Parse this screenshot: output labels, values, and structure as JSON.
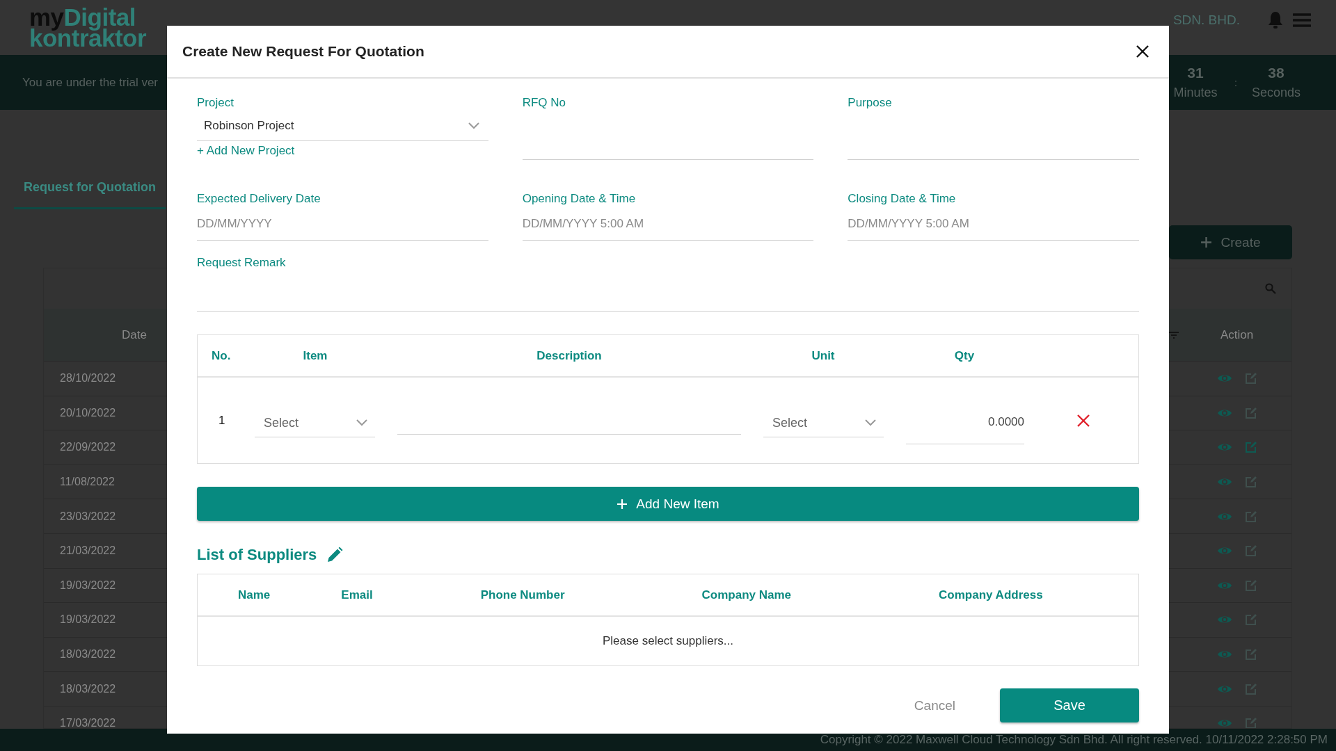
{
  "app": {
    "logo": {
      "part1": "my",
      "part2": "Digital",
      "line2": "kontraktor"
    },
    "company": "SDN. BHD.",
    "trial_banner": "You are under the trial ver",
    "countdown": [
      {
        "value": "31",
        "unit": "Minutes"
      },
      {
        "value": "38",
        "unit": "Seconds"
      }
    ],
    "countdown_separator": ":",
    "tabs": [
      {
        "label": "Request for Quotation",
        "selected": true
      }
    ],
    "create_button": "Create",
    "table": {
      "columns": [
        "Date",
        "Action"
      ],
      "rows": [
        {
          "date": "28/10/2022",
          "edit_highlighted": false
        },
        {
          "date": "20/10/2022",
          "edit_highlighted": false
        },
        {
          "date": "22/09/2022",
          "edit_highlighted": true
        },
        {
          "date": "11/08/2022",
          "edit_highlighted": false
        },
        {
          "date": "23/03/2022",
          "edit_highlighted": false
        },
        {
          "date": "21/03/2022",
          "edit_highlighted": false
        },
        {
          "date": "19/03/2022",
          "edit_highlighted": false
        },
        {
          "date": "19/03/2022",
          "edit_highlighted": false
        },
        {
          "date": "18/03/2022",
          "edit_highlighted": false
        },
        {
          "date": "18/03/2022",
          "edit_highlighted": false
        },
        {
          "date": "17/03/2022",
          "edit_highlighted": false
        }
      ]
    },
    "footer": "Copyright © 2022 Maxwell Cloud Technology Sdn Bhd. All right reserved. 10/11/2022 2:28:50 PM"
  },
  "modal": {
    "title": "Create New Request For Quotation",
    "fields": [
      {
        "label": "Project",
        "kind": "select",
        "value": "Robinson Project",
        "link": "+ Add New Project"
      },
      {
        "label": "RFQ No",
        "kind": "text"
      },
      {
        "label": "Purpose",
        "kind": "text"
      },
      {
        "label": "Expected Delivery Date",
        "kind": "text",
        "placeholder": "DD/MM/YYYY"
      },
      {
        "label": "Opening Date & Time",
        "kind": "text",
        "placeholder": "DD/MM/YYYY 5:00 AM"
      },
      {
        "label": "Closing Date & Time",
        "kind": "text",
        "placeholder": "DD/MM/YYYY 5:00 AM"
      },
      {
        "label": "Request Remark",
        "kind": "remark"
      }
    ],
    "items": {
      "columns": [
        "No.",
        "Item",
        "Description",
        "Unit",
        "Qty"
      ],
      "rows": [
        {
          "no": "1",
          "item_placeholder": "Select",
          "unit_placeholder": "Select",
          "qty": "0.0000"
        }
      ]
    },
    "add_item_button": "Add New Item",
    "suppliers": {
      "title": "List of Suppliers",
      "columns": [
        "Name",
        "Email",
        "Phone Number",
        "Company Name",
        "Company Address"
      ],
      "empty_text": "Please select suppliers..."
    },
    "buttons": {
      "cancel": "Cancel",
      "save": "Save"
    }
  }
}
